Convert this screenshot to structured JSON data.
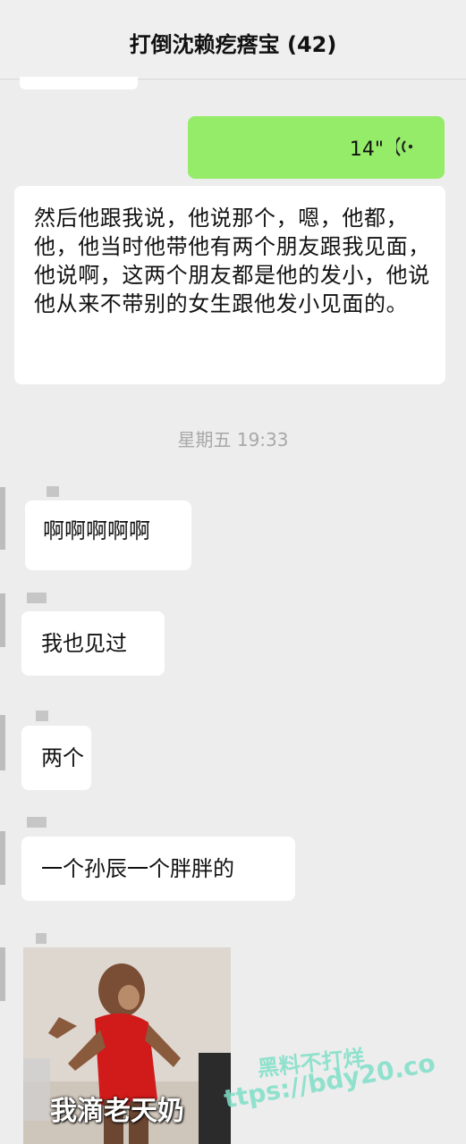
{
  "header": {
    "title": "打倒沈赖疙瘩宝 (42)"
  },
  "messages": {
    "voice_duration": "14\"",
    "long_text": "然后他跟我说，他说那个，嗯，他都，他，他当时他带他有两个朋友跟我见面，他说啊，这两个朋友都是他的发小，他说他从来不带别的女生跟他发小见面的。",
    "timestamp": "星期五 19:33",
    "msg1": "啊啊啊啊啊",
    "msg2": "我也见过",
    "msg3": "两个",
    "msg4": "一个孙辰一个胖胖的",
    "sticker_caption": "我滴老天奶"
  },
  "watermark": {
    "line1": "黑料不打烊",
    "line2": "ttps://bdy20.co"
  },
  "colors": {
    "self_bubble": "#95ec69",
    "other_bubble": "#ffffff",
    "background": "#ededed"
  }
}
